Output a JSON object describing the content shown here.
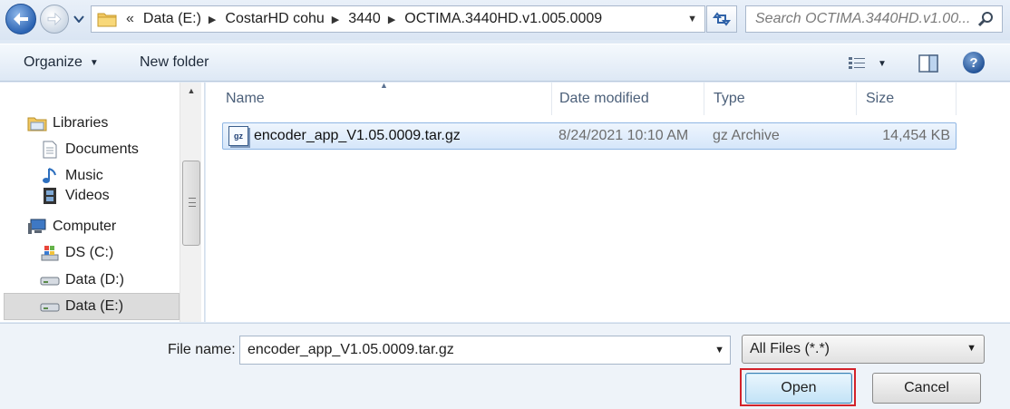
{
  "address_bar": {
    "breadcrumbs": [
      "Data (E:)",
      "CostarHD cohu",
      "3440",
      "OCTIMA.3440HD.v1.005.0009"
    ],
    "overflow": "«"
  },
  "search": {
    "placeholder": "Search OCTIMA.3440HD.v1.00..."
  },
  "toolbar": {
    "organize_label": "Organize",
    "new_folder_label": "New folder"
  },
  "nav": {
    "libraries": "Libraries",
    "documents": "Documents",
    "music": "Music",
    "videos": "Videos",
    "computer": "Computer",
    "drive_c": "DS (C:)",
    "drive_d": "Data (D:)",
    "drive_e": "Data (E:)"
  },
  "columns": {
    "name": "Name",
    "date": "Date modified",
    "type": "Type",
    "size": "Size"
  },
  "files": [
    {
      "name": "encoder_app_V1.05.0009.tar.gz",
      "date": "8/24/2021 10:10 AM",
      "type": "gz Archive",
      "size": "14,454 KB",
      "icon_text": "gz"
    }
  ],
  "file_name": {
    "label": "File name:",
    "value": "encoder_app_V1.05.0009.tar.gz"
  },
  "filter": {
    "value": "All Files (*.*)"
  },
  "buttons": {
    "open": "Open",
    "cancel": "Cancel"
  },
  "colors": {
    "selection": "#d5e6fa",
    "highlight_outline": "#d3222a",
    "chrome": "#dfe9f5"
  }
}
